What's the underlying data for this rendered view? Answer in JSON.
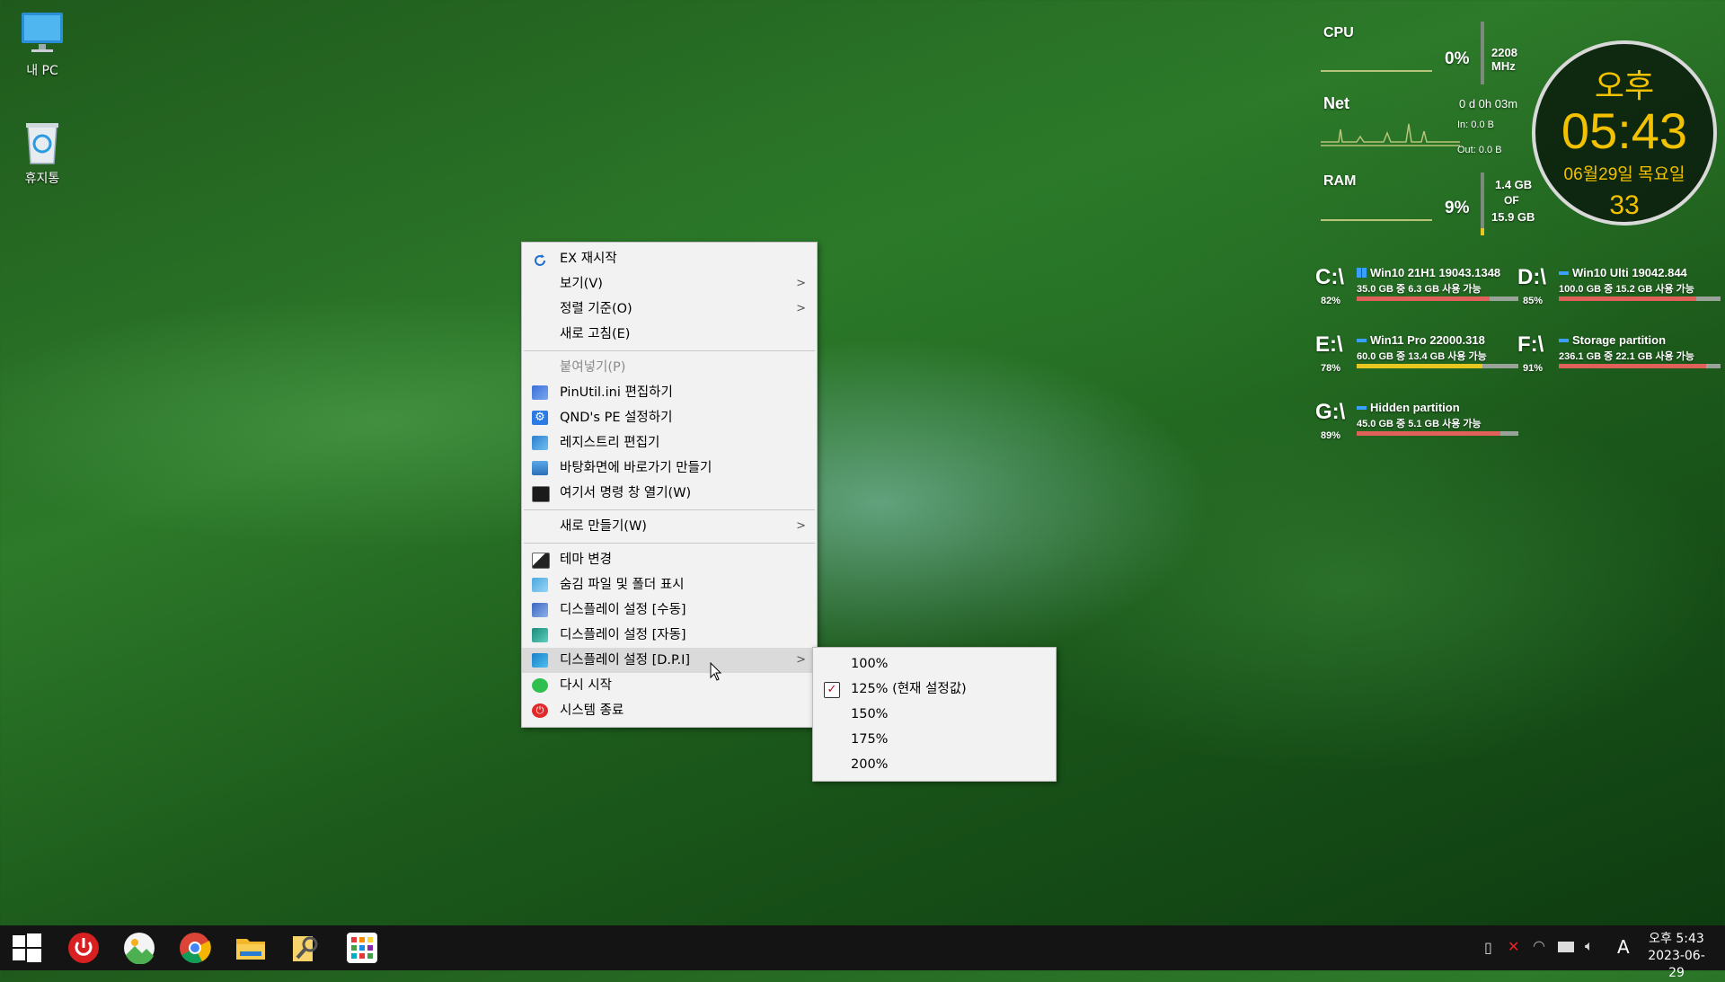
{
  "desktop": {
    "icons": [
      {
        "label": "내 PC",
        "icon": "computer-icon"
      },
      {
        "label": "휴지통",
        "icon": "recycle-bin-icon"
      }
    ]
  },
  "context_menu": {
    "items": [
      {
        "label": "EX 재시작",
        "icon": "refresh-icon"
      },
      {
        "label": "보기(V)",
        "submenu": true
      },
      {
        "label": "정렬 기준(O)",
        "submenu": true
      },
      {
        "label": "새로 고침(E)"
      },
      {
        "label": "붙여넣기(P)",
        "disabled": true
      },
      {
        "label": "PinUtil.ini 편집하기",
        "icon": "edit-ini-icon"
      },
      {
        "label": "QND's PE 설정하기",
        "icon": "gear-icon"
      },
      {
        "label": "레지스트리 편집기",
        "icon": "registry-icon"
      },
      {
        "label": "바탕화면에 바로가기 만들기",
        "icon": "shortcut-icon"
      },
      {
        "label": "여기서 명령 창 열기(W)",
        "icon": "terminal-icon"
      },
      {
        "label": "새로 만들기(W)",
        "submenu": true
      },
      {
        "label": "테마 변경",
        "icon": "theme-icon"
      },
      {
        "label": "숨김 파일 및 폴더 표시",
        "icon": "hidden-files-icon"
      },
      {
        "label": "디스플레이 설정 [수동]",
        "icon": "display-manual-icon"
      },
      {
        "label": "디스플레이 설정 [자동]",
        "icon": "display-auto-icon"
      },
      {
        "label": "디스플레이 설정 [D.P.I]",
        "icon": "display-dpi-icon",
        "submenu": true
      },
      {
        "label": "다시 시작",
        "icon": "restart-icon"
      },
      {
        "label": "시스템 종료",
        "icon": "power-icon"
      }
    ]
  },
  "dpi_submenu": {
    "items": [
      {
        "label": "100%"
      },
      {
        "label": "125% (현재 설정값)",
        "checked": true
      },
      {
        "label": "150%"
      },
      {
        "label": "175%"
      },
      {
        "label": "200%"
      }
    ]
  },
  "system_monitor": {
    "cpu": {
      "label": "CPU",
      "percent": "0%",
      "freq": "2208 MHz"
    },
    "net": {
      "label": "Net",
      "uptime": "0 d 0h 03m",
      "in": "In: 0.0 B",
      "out": "Out: 0.0 B"
    },
    "ram": {
      "label": "RAM",
      "percent": "9%",
      "used": "1.4 GB",
      "of": "OF",
      "total": "15.9 GB"
    }
  },
  "clock": {
    "ampm": "오후",
    "time": "05:43",
    "date": "06월29일 목요일",
    "seconds": "33"
  },
  "drives": [
    {
      "letter": "C:\\",
      "pct": "82%",
      "name": "Win10 21H1 19043.1348",
      "info": "35.0 GB 중   6.3 GB 사용 가능",
      "fill": 0.82,
      "color": "#e0605a",
      "mark": "windows"
    },
    {
      "letter": "D:\\",
      "pct": "85%",
      "name": "Win10 Ulti 19042.844",
      "info": "100.0 GB 중  15.2 GB 사용 가능",
      "fill": 0.85,
      "color": "#e0605a",
      "mark": "dash"
    },
    {
      "letter": "E:\\",
      "pct": "78%",
      "name": "Win11 Pro 22000.318",
      "info": "60.0 GB 중   13.4 GB 사용 가능",
      "fill": 0.78,
      "color": "#e8c820",
      "mark": "dash"
    },
    {
      "letter": "F:\\",
      "pct": "91%",
      "name": "Storage partition",
      "info": "236.1 GB 중  22.1 GB 사용 가능",
      "fill": 0.91,
      "color": "#e0605a",
      "mark": "dash"
    },
    {
      "letter": "G:\\",
      "pct": "89%",
      "name": "Hidden partition",
      "info": "45.0 GB 중    5.1 GB 사용 가능",
      "fill": 0.89,
      "color": "#e0605a",
      "mark": "dash"
    }
  ],
  "taskbar": {
    "apps": [
      "windows-start-icon",
      "power-icon",
      "photos-icon",
      "chrome-icon",
      "file-explorer-icon",
      "search-tool-icon",
      "apps-grid-icon"
    ],
    "tray_ime": "A",
    "time": "오후 5:43",
    "date": "2023-06-29"
  }
}
